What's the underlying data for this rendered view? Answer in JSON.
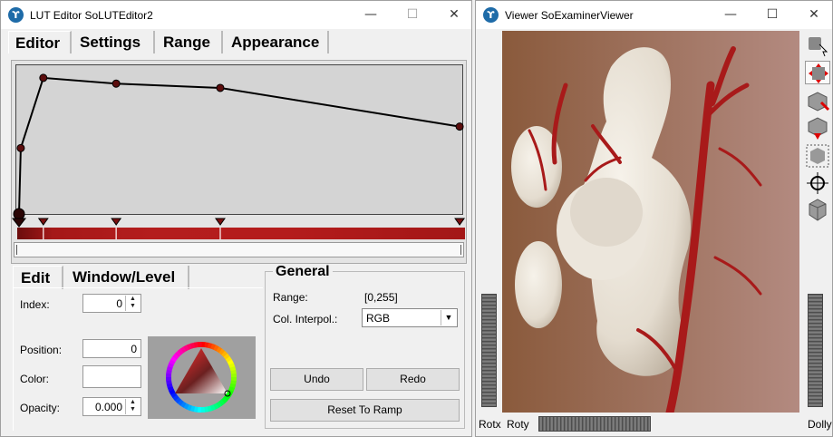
{
  "lut_window": {
    "title": "LUT Editor SoLUTEditor2",
    "controls": {
      "minimize": "—",
      "maximize": "☐",
      "close": "✕"
    },
    "tabs": [
      "Editor",
      "Settings",
      "Range",
      "Appearance"
    ],
    "active_tab": "Editor",
    "transfer_function": {
      "points": [
        [
          0,
          0
        ],
        [
          1,
          0.46
        ],
        [
          14,
          0.95
        ],
        [
          56,
          0.91
        ],
        [
          116,
          0.88
        ],
        [
          254,
          0.61
        ]
      ],
      "selected_index": 0,
      "color": "#5c0d0d"
    },
    "lower_tabs": [
      "Edit",
      "Window/Level"
    ],
    "edit": {
      "index_label": "Index:",
      "index_value": "0",
      "position_label": "Position:",
      "position_value": "0",
      "color_label": "Color:",
      "opacity_label": "Opacity:",
      "opacity_value": "0.000"
    },
    "general": {
      "title": "General",
      "range_label": "Range:",
      "range_value": "[0,255]",
      "interp_label": "Col. Interpol.:",
      "interp_value": "RGB",
      "undo": "Undo",
      "redo": "Redo",
      "reset": "Reset To Ramp"
    }
  },
  "viewer_window": {
    "title": "Viewer SoExaminerViewer",
    "controls": {
      "minimize": "—",
      "maximize": "☐",
      "close": "✕"
    },
    "tools": [
      "pick-arrow-icon",
      "rotate-hand-icon",
      "home-icon",
      "set-home-icon",
      "view-all-icon",
      "seek-icon",
      "perspective-icon"
    ],
    "bottom": {
      "rotx": "Rotx",
      "roty": "Roty",
      "dolly": "Dolly"
    },
    "colors": {
      "bone": "#ece6dc",
      "vessel": "#a81a1a",
      "background_left": "#8a5a3c",
      "background_right": "#b38a80"
    }
  }
}
